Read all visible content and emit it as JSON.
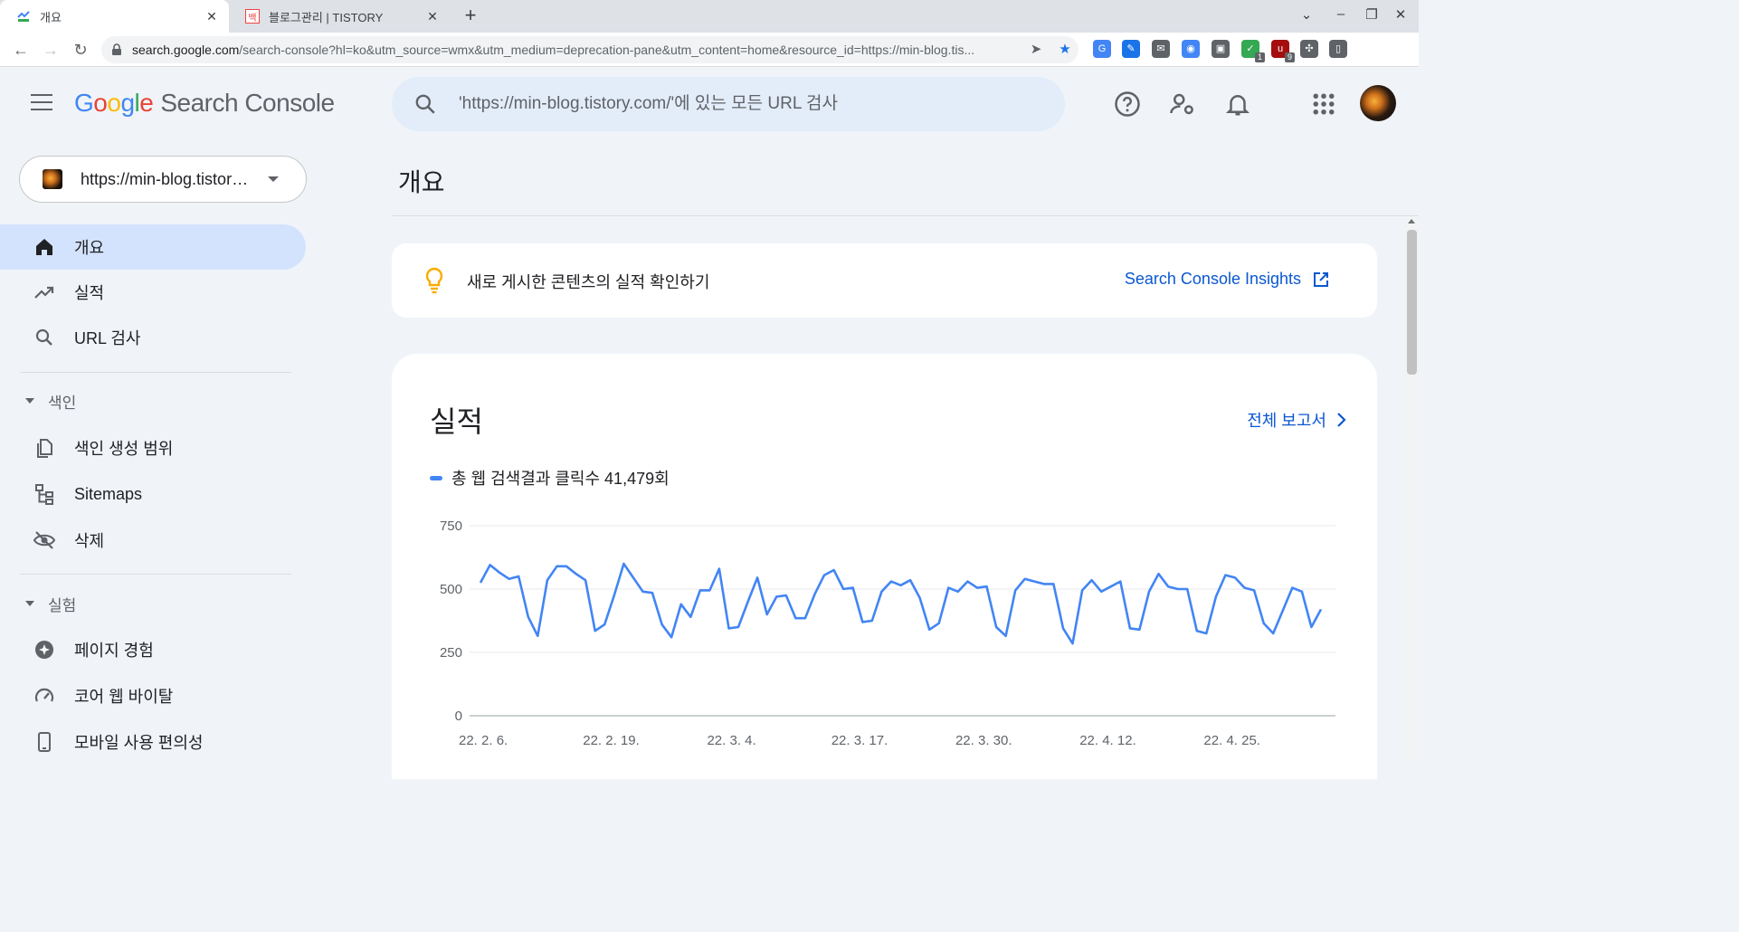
{
  "browser": {
    "tabs": [
      {
        "title": "개요",
        "active": true
      },
      {
        "title": "블로그관리 | TISTORY",
        "favicon_text": "백",
        "active": false
      }
    ],
    "tab_close": "✕",
    "new_tab": "+",
    "url_host": "search.google.com",
    "url_rest": "/search-console?hl=ko&utm_source=wmx&utm_medium=deprecation-pane&utm_content=home&resource_id=https://min-blog.tis...",
    "extensions": [
      {
        "name": "translate-extension",
        "color": "#4285f4",
        "text": "G"
      },
      {
        "name": "pen-extension",
        "color": "#1a73e8",
        "text": "✎"
      },
      {
        "name": "mail-extension",
        "color": "#5f6368",
        "text": "✉"
      },
      {
        "name": "globe-extension",
        "color": "#4285f4",
        "text": "◉"
      },
      {
        "name": "portrait-extension",
        "color": "#5f6368",
        "text": "▣"
      },
      {
        "name": "shield-check-extension",
        "color": "#34a853",
        "text": "✓",
        "badge": "1"
      },
      {
        "name": "ublock-extension",
        "color": "#a50e0e",
        "text": "u",
        "badge": "9"
      },
      {
        "name": "puzzle-extension",
        "color": "#5f6368",
        "text": "✣"
      },
      {
        "name": "sidepanel-extension",
        "color": "#5f6368",
        "text": "▯"
      }
    ]
  },
  "header": {
    "logo_g": [
      "G",
      "o",
      "o",
      "g",
      "l",
      "e"
    ],
    "product": "Search Console",
    "search_placeholder": "'https://min-blog.tistory.com/'에 있는 모든 URL 검사"
  },
  "sidebar": {
    "property": "https://min-blog.tistory.com/",
    "items_main": [
      {
        "label": "개요",
        "icon": "home-icon",
        "selected": true
      },
      {
        "label": "실적",
        "icon": "trending-up-icon",
        "selected": false
      },
      {
        "label": "URL 검사",
        "icon": "search-icon",
        "selected": false
      }
    ],
    "section_index": "색인",
    "items_index": [
      {
        "label": "색인 생성 범위",
        "icon": "file-copy-icon"
      },
      {
        "label": "Sitemaps",
        "icon": "sitemap-icon"
      },
      {
        "label": "삭제",
        "icon": "visibility-off-icon"
      }
    ],
    "section_experience": "실험",
    "items_experience": [
      {
        "label": "페이지 경험",
        "icon": "badge-icon"
      },
      {
        "label": "코어 웹 바이탈",
        "icon": "speed-icon"
      },
      {
        "label": "모바일 사용 편의성",
        "icon": "smartphone-icon"
      }
    ]
  },
  "main": {
    "page_title": "개요",
    "insight_text": "새로 게시한 콘텐츠의 실적 확인하기",
    "insight_link": "Search Console Insights",
    "performance_title": "실적",
    "full_report": "전체 보고서",
    "legend": "총 웹 검색결과 클릭수 41,479회"
  },
  "chart_data": {
    "type": "line",
    "ylim": [
      0,
      750
    ],
    "yticks": [
      "750",
      "500",
      "250",
      "0"
    ],
    "xticks": [
      "22. 2. 6.",
      "22. 2. 19.",
      "22. 3. 4.",
      "22. 3. 17.",
      "22. 3. 30.",
      "22. 4. 12.",
      "22. 4. 25."
    ],
    "color": "#4285f4",
    "series": [
      {
        "values": [
          525,
          595,
          565,
          540,
          550,
          390,
          315,
          535,
          590,
          590,
          560,
          535,
          335,
          360,
          475,
          600,
          545,
          490,
          485,
          360,
          310,
          440,
          390,
          495,
          495,
          580,
          345,
          350,
          450,
          545,
          400,
          470,
          475,
          385,
          385,
          480,
          555,
          575,
          500,
          505,
          370,
          375,
          490,
          530,
          515,
          535,
          465,
          340,
          365,
          505,
          490,
          530,
          505,
          510,
          350,
          315,
          495,
          540,
          530,
          520,
          520,
          345,
          285,
          495,
          535,
          490,
          510,
          530,
          345,
          340,
          490,
          560,
          510,
          500,
          500,
          335,
          325,
          470,
          555,
          545,
          505,
          495,
          365,
          325,
          415,
          505,
          490,
          350,
          420
        ]
      }
    ]
  }
}
